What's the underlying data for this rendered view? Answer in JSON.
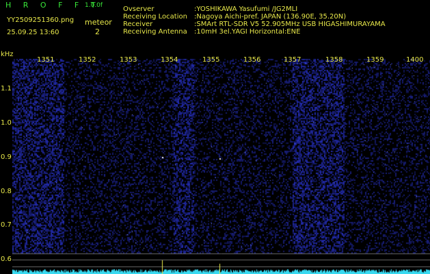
{
  "app": {
    "title": "H R O F F T",
    "version": "1.0.0f"
  },
  "file": {
    "name": "YY2509251360.png",
    "datetime": "25.09.25 13:60"
  },
  "mode": {
    "label": "meteor",
    "count": "2"
  },
  "info": [
    {
      "label": "Ovserver",
      "value": ":YOSHIKAWA Yasufumi /JG2MLI"
    },
    {
      "label": "Receiving Location",
      "value": ":Nagoya Aichi-pref. JAPAN (136.90E, 35.20N)"
    },
    {
      "label": "Receiver",
      "value": ":SMArt RTL-SDR V5 52.905MHz USB HIGASHIMURAYAMA"
    },
    {
      "label": "Receiving Antenna",
      "value": ":10mH 3el.YAGI Horizontal:ENE"
    }
  ],
  "axis": {
    "y_unit": "kHz",
    "y_ticks": [
      "1.1",
      "1.0",
      "0.9",
      "0.8",
      "0.7",
      "0.6"
    ],
    "x_ticks": [
      "1351",
      "1352",
      "1353",
      "1354",
      "1355",
      "1356",
      "1357",
      "1358",
      "1359",
      "1400"
    ]
  },
  "colors": {
    "text_green": "#39e639",
    "text_yellow": "#e8e84a",
    "background": "#000000",
    "noise": "#1a1f8c",
    "spectrum": "#38d9f0"
  }
}
